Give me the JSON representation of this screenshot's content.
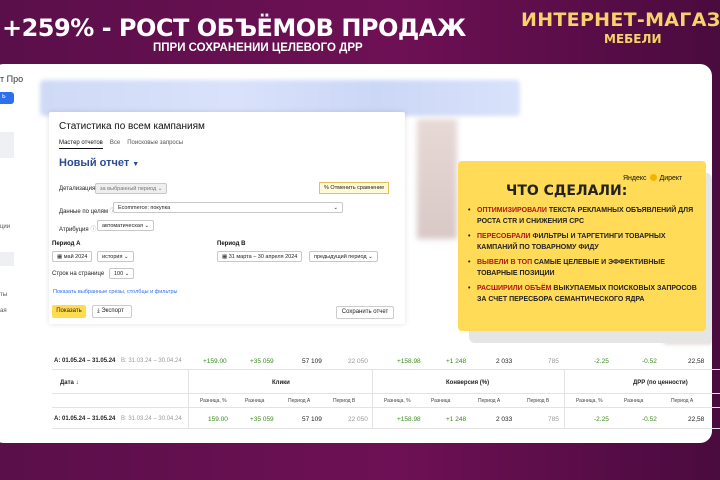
{
  "header": {
    "title": "+259% - РОСТ ОБЪЁМОВ ПРОДАЖ",
    "subtitle_prefix": "ППРИ СОХРАНЕНИИ ЦЕЛЕВОГО",
    "subtitle_bold": "ДРР"
  },
  "brand": {
    "line1": "ИНТЕРНЕТ-МАГАЗ",
    "line2": "МЕБЕЛИ"
  },
  "sidebar": {
    "logo": "т Про",
    "button": "ь",
    "items": [
      "ции",
      "ты",
      "ая"
    ]
  },
  "panel": {
    "title": "Статистика по всем кампаниям",
    "tabs": [
      "Мастер отчетов",
      "Все",
      "Поисковые запросы"
    ],
    "report_name": "Новый отчет",
    "detail_label": "Детализация",
    "detail_value": "за выбранный период",
    "compare_button": "Отменить сравнение",
    "goals_label": "Данные по целям",
    "goals_value": "Ecommerce: покупка",
    "attribution_label": "Атрибуция",
    "attribution_value": "автоматическая",
    "period_a_label": "Период А",
    "period_a_value": "май 2024",
    "period_a_mode": "история",
    "period_b_label": "Период В",
    "period_b_value": "31 марта – 30 апреля 2024",
    "period_b_mode": "предыдущий период",
    "rows_label": "Строк на странице",
    "rows_value": "100",
    "link": "Показать выбранные срезы, столбцы и фильтры",
    "show_button": "Показать",
    "export_button": "Экспорт",
    "save_button": "Сохранить отчет"
  },
  "callout": {
    "badge": "Яндекс",
    "badge2": "Директ",
    "title": "ЧТО СДЕЛАЛИ:",
    "items": [
      {
        "hl": "ОПТИМИЗИРОВАЛИ",
        "text": " ТЕКСТА РЕКЛАМНЫХ ОБЪЯВЛЕНИЙ ДЛЯ РОСТА CTR И СНИЖЕНИЯ CPC"
      },
      {
        "hl": "ПЕРЕСОБРАЛИ",
        "text": " ФИЛЬТРЫ И ТАРГЕТИНГИ ТОВАРНЫХ КАМПАНИЙ ПО ТОВАРНОМУ ФИДУ"
      },
      {
        "hl": "ВЫВЕЛИ В ТОП",
        "text": " САМЫЕ ЦЕЛЕВЫЕ И ЭФФЕКТИВНЫЕ ТОВАРНЫЕ ПОЗИЦИИ"
      },
      {
        "hl": "РАСШИРИЛИ ОБЪЁМ",
        "text": " ВЫКУПАЕМЫХ ПОИСКОВЫХ ЗАПРОСОВ ЗА СЧЕТ ПЕРЕСБОРА СЕМАНТИЧЕСКОГО ЯДРА"
      }
    ]
  },
  "table": {
    "summary": {
      "period_a": "А: 01.05.24 – 31.05.24",
      "period_b": "В: 31.03.24 – 30.04.24",
      "values": [
        "+159.00",
        "+35 059",
        "57 109",
        "22 050",
        "+158.98",
        "+1 248",
        "2 033",
        "785",
        "-2.25",
        "-0.52",
        "22,58"
      ]
    },
    "headers": {
      "date": "Дата",
      "clicks": "Клики",
      "conversion": "Конверсия (%)",
      "drr": "ДРР (по ценности)"
    },
    "subheaders": [
      "Разница, %",
      "Разница",
      "Период А",
      "Период В",
      "Разница, %",
      "Разница",
      "Период А",
      "Период В",
      "Разница, %",
      "Разница",
      "Период А"
    ],
    "row": {
      "period_a": "А: 01.05.24 – 31.05.24",
      "period_b": "В: 31.03.24 – 30.04.24",
      "values": [
        "159.00",
        "+35 059",
        "57 109",
        "22 050",
        "+158.98",
        "+1 248",
        "2 033",
        "785",
        "-2.25",
        "-0.52",
        "22,58"
      ]
    }
  }
}
